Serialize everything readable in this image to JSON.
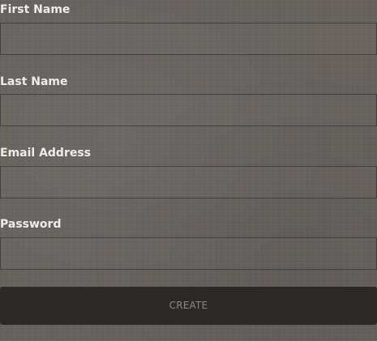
{
  "form": {
    "first_name": {
      "label": "First Name",
      "value": ""
    },
    "last_name": {
      "label": "Last Name",
      "value": ""
    },
    "email": {
      "label": "Email Address",
      "value": ""
    },
    "password": {
      "label": "Password",
      "value": ""
    },
    "submit_label": "CREATE"
  },
  "colors": {
    "background": "#67625e",
    "label_text": "#f0ece8",
    "button_bg": "#2d2927",
    "button_text": "#8c8782",
    "field_border": "#3a3532"
  }
}
